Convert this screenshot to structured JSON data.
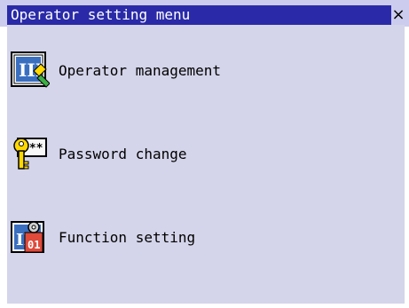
{
  "window": {
    "title": "Operator setting menu",
    "close_label": "×"
  },
  "menu": {
    "items": [
      {
        "label": "Operator management",
        "icon": "operator-management-icon"
      },
      {
        "label": "Password change",
        "icon": "password-key-icon"
      },
      {
        "label": "Function setting",
        "icon": "function-setting-icon"
      }
    ]
  },
  "colors": {
    "title_bar": "#2a2aa8",
    "client_background": "#d4d4ea",
    "title_text": "#ffffff"
  }
}
